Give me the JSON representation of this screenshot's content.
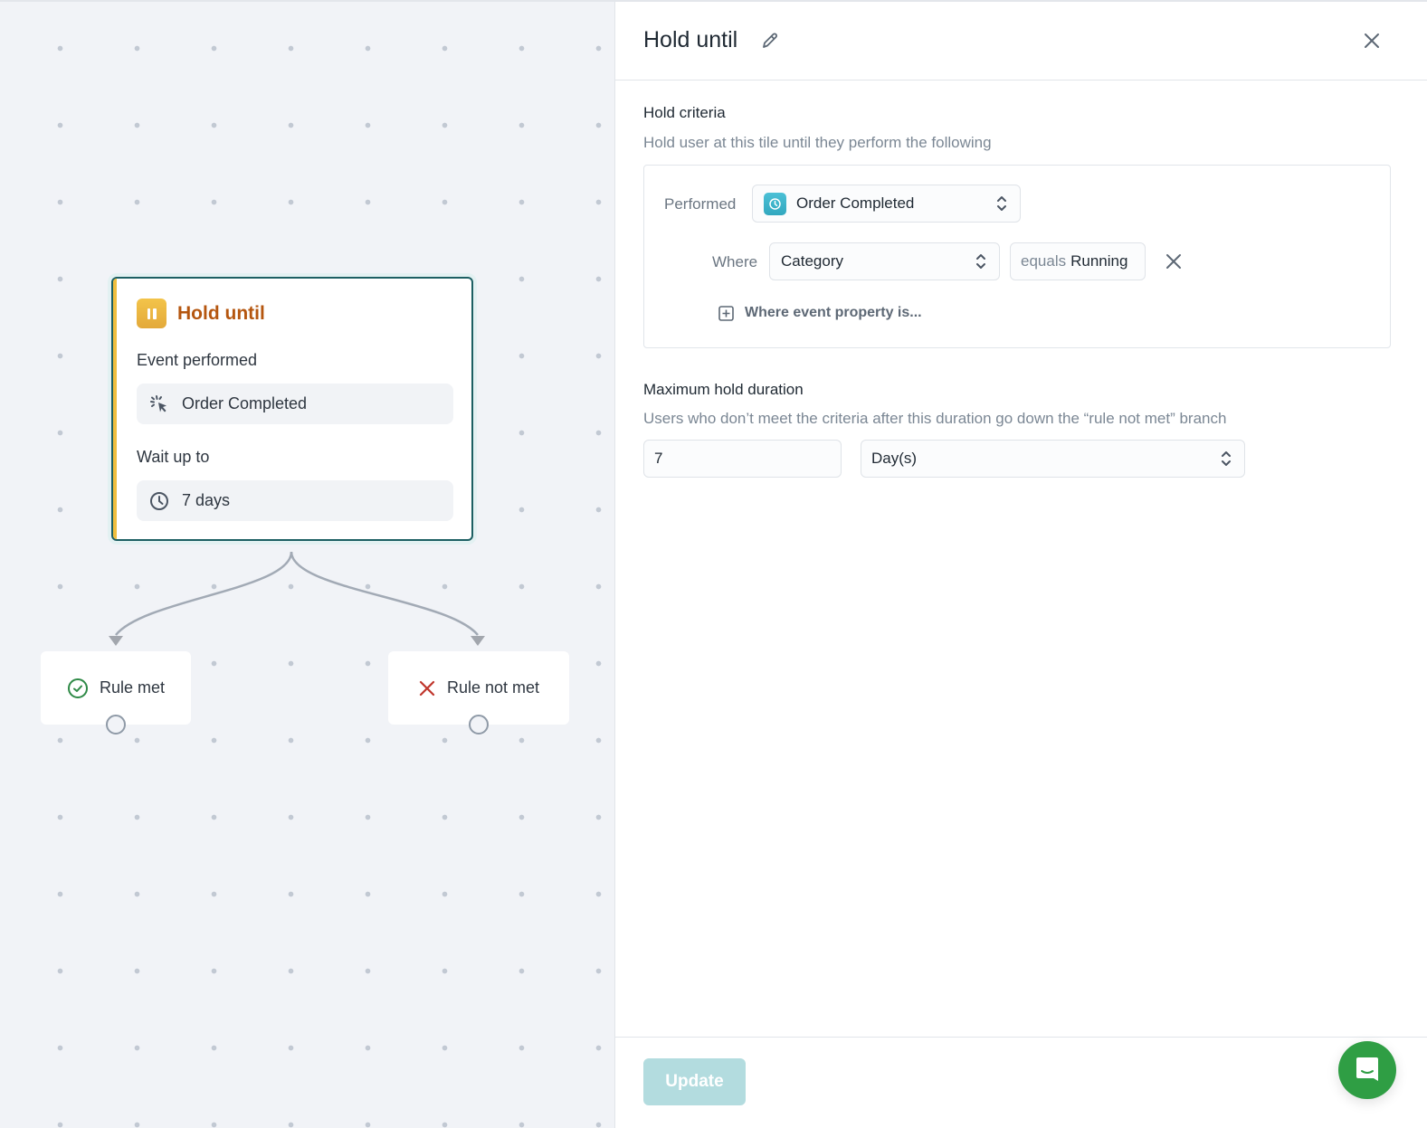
{
  "canvas": {
    "tile": {
      "title": "Hold until",
      "icon": "pause-icon",
      "event_label": "Event performed",
      "event_value": "Order Completed",
      "event_icon": "cursor-click-icon",
      "wait_label": "Wait up to",
      "wait_value": "7 days",
      "wait_icon": "clock-icon",
      "accent_color": "#b5560f",
      "border_color": "#1d5f63"
    },
    "branches": [
      {
        "label": "Rule met",
        "icon": "check-circle-icon",
        "color": "#2f8a47"
      },
      {
        "label": "Rule not met",
        "icon": "x-icon",
        "color": "#c0362c"
      }
    ]
  },
  "panel": {
    "title": "Hold until",
    "edit_icon": "pencil-icon",
    "close_icon": "close-icon",
    "hold_criteria": {
      "title": "Hold criteria",
      "subtitle": "Hold user at this tile until they perform the following",
      "performed_label": "Performed",
      "event_select": "Order Completed",
      "where_label": "Where",
      "property_select": "Category",
      "operator": "equals",
      "value": "Running",
      "add_property_label": "Where event property is..."
    },
    "max_duration": {
      "title": "Maximum hold duration",
      "subtitle": "Users who don’t meet the criteria after this duration go down the “rule not met” branch",
      "amount": "7",
      "unit": "Day(s)"
    },
    "footer": {
      "update_label": "Update"
    }
  },
  "chat_widget": {
    "icon": "chat-bubble-icon",
    "color": "#2f9e44"
  }
}
